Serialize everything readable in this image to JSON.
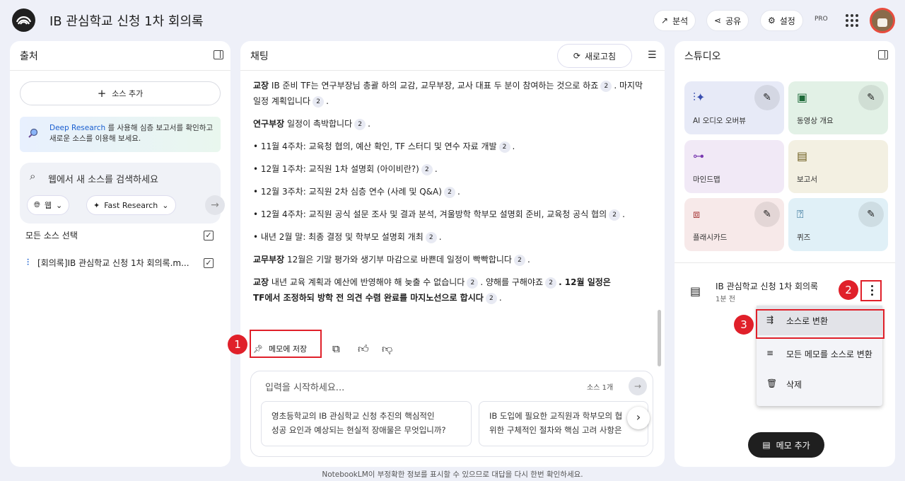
{
  "app": {
    "title": "IB 관심학교 신청 1차 회의록",
    "header_buttons": {
      "analyze": "분석",
      "share": "공유",
      "settings": "설정"
    },
    "pro_label": "PRO"
  },
  "sources": {
    "title": "출처",
    "add_source": "소스 추가",
    "deep_research_link": "Deep Research",
    "deep_research_line1": "를 사용해 심층 보고서를 확인하고",
    "deep_research_line2": "새로운 소스를 이용해 보세요.",
    "search_placeholder": "웹에서 새 소스를 검색하세요",
    "web_pill": "웹",
    "research_pill": "Fast Research",
    "select_all": "모든 소스 선택",
    "items": [
      {
        "label": "[회의록]IB 관심학교 신청 1차 회의록.m...",
        "checked": true
      }
    ]
  },
  "chat": {
    "title": "채팅",
    "refresh": "새로고침",
    "paragraphs": [
      {
        "speaker": "교장",
        "text": "IB 준비 TF는 연구부장님 총괄 하의 교감, 교무부장, 교사 대표 두 분이 참여하는 것으로 하죠",
        "cite": "2",
        "text2": ". 마지막 일정 계획입니다",
        "cite2": "2",
        "tail": "."
      },
      {
        "speaker": "연구부장",
        "text": "일정이 촉박합니다",
        "cite": "2",
        "tail": "."
      }
    ],
    "bullets": [
      {
        "text": "• 11월 4주차: 교육청 협의, 예산 확인, TF 스터디 및 연수 자료 개발",
        "cite": "2"
      },
      {
        "text": "• 12월 1주차: 교직원 1차 설명회 (아이비란?)",
        "cite": "2"
      },
      {
        "text": "• 12월 3주차: 교직원 2차 심층 연수 (사례 및 Q&A)",
        "cite": "2"
      },
      {
        "text": "• 12월 4주차: 교직원 공식 설문 조사 및 결과 분석, 겨울방학 학부모 설명회 준비, 교육청 공식 협의",
        "cite": "2"
      },
      {
        "text": "• 내년 2월 말: 최종 결정 및 학부모 설명회 개최",
        "cite": "2"
      }
    ],
    "p_kyomu": {
      "speaker": "교무부장",
      "text": "12월은 기말 평가와 생기부 마감으로 바쁜데 일정이 빡빡합니다",
      "cite": "2"
    },
    "p_last": {
      "speaker": "교장",
      "text": "내년 교육 계획과 예산에 반영해야 해 늦출 수 없습니다",
      "cite": "2",
      "text2": ". 양해를 구해야죠",
      "cite2": "2",
      "bold1": ". 12월 일정은",
      "bold2": "TF에서 조정하되 방학 전 의견 수렴 완료를 마지노선으로 합시다",
      "cite3": "2"
    },
    "save_memo": "메모에 저장",
    "input_placeholder": "입력을 시작하세요...",
    "source_count": "소스 1개",
    "suggestions": [
      {
        "line1": "영초등학교의 IB 관심학교 신청 추진의 핵심적인",
        "line2": "성공 요인과 예상되는 현실적 장애물은 무엇입니까?"
      },
      {
        "line1": "IB 도입에 필요한 교직원과 학부모의 협",
        "line2": "위한 구체적인 절차와 핵심 고려 사항은"
      }
    ]
  },
  "studio": {
    "title": "스튜디오",
    "cards": [
      {
        "label": "AI 오디오 오버뷰",
        "color": "#e7eaf7",
        "icon": "audio-wave-icon",
        "editable": true
      },
      {
        "label": "동영상 개요",
        "color": "#e2f1e6",
        "icon": "video-icon",
        "editable": true
      },
      {
        "label": "마인드맵",
        "color": "#f1e9f6",
        "icon": "mindmap-icon",
        "editable": false
      },
      {
        "label": "보고서",
        "color": "#f3f0e2",
        "icon": "report-icon",
        "editable": false
      },
      {
        "label": "플래시카드",
        "color": "#f7e9e9",
        "icon": "flashcard-icon",
        "editable": true
      },
      {
        "label": "퀴즈",
        "color": "#e0f0f7",
        "icon": "quiz-icon",
        "editable": true
      }
    ],
    "memo_title": "IB 관심학교 신청 1차 회의록",
    "memo_time": "1분 전",
    "menu": [
      "소스로 변환",
      "모든 메모를 소스로 변환",
      "삭제"
    ],
    "add_memo": "메모 추가"
  },
  "annotations": [
    "1",
    "2",
    "3"
  ],
  "annotation_color": "#e0202a",
  "footer": "NotebookLM이 부정확한 정보를 표시할 수 있으므로 대답을 다시 한번 확인하세요."
}
